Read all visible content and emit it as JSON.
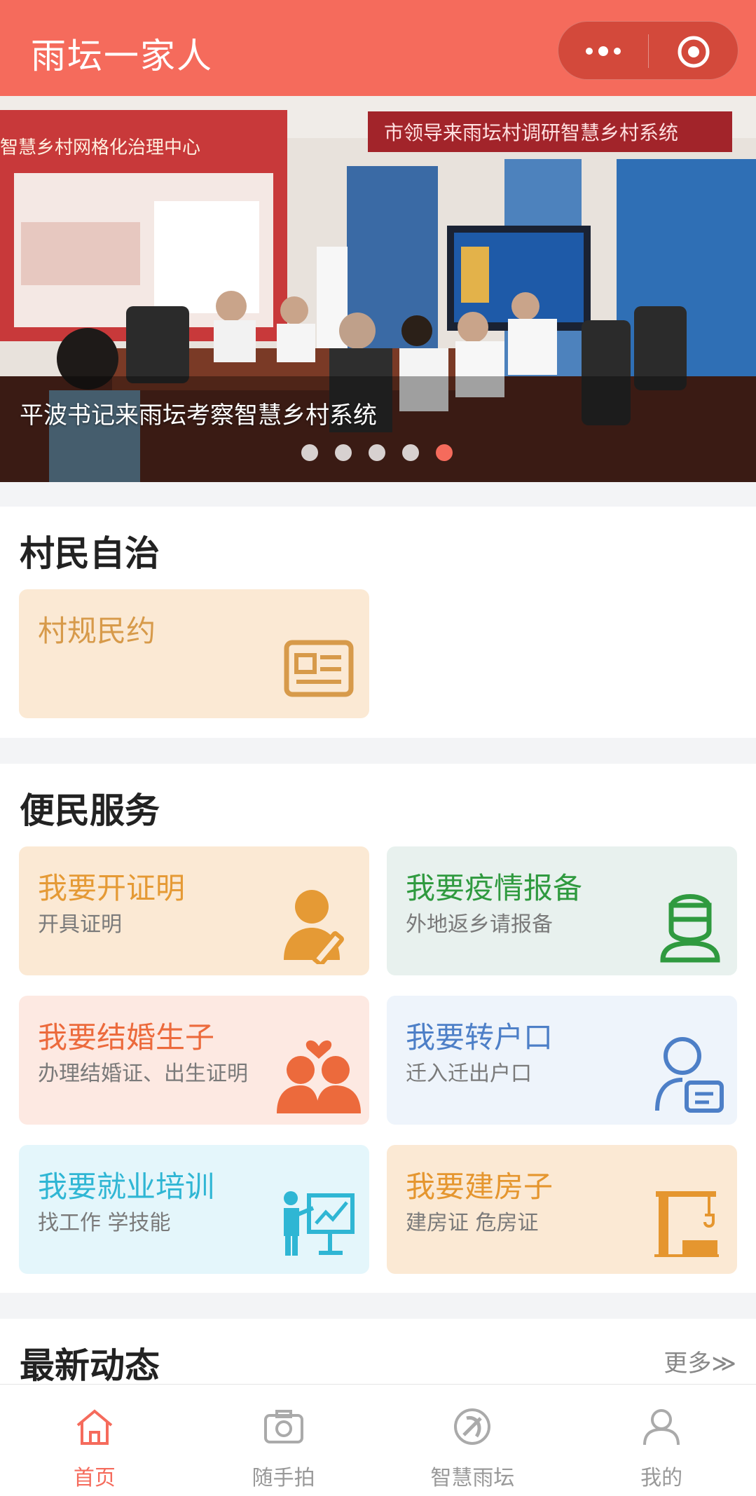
{
  "app": {
    "title": "雨坛一家人"
  },
  "banner": {
    "caption": "平波书记来雨坛考察智慧乡村系统",
    "sign_text": "市领导来雨坛村调研智慧乡村系统",
    "wall_text": "智慧乡村网格化治理中心",
    "page_count": 5,
    "active_index": 4
  },
  "section1": {
    "heading": "村民自治",
    "cards": [
      {
        "title": "村规民约",
        "icon": "document-icon",
        "color": "#d79a4a",
        "bg": "#fbe9d4"
      }
    ]
  },
  "section2": {
    "heading": "便民服务",
    "cards": [
      {
        "title": "我要开证明",
        "subtitle": "开具证明",
        "icon": "person-pen-icon",
        "color": "#e59a35",
        "bg": "#fbe9d4"
      },
      {
        "title": "我要疫情报备",
        "subtitle": "外地返乡请报备",
        "icon": "masked-person-icon",
        "color": "#2f9a3f",
        "bg": "#e8f1ee"
      },
      {
        "title": "我要结婚生子",
        "subtitle": "办理结婚证、出生证明",
        "icon": "couple-heart-icon",
        "color": "#ec6a3c",
        "bg": "#fde9e2"
      },
      {
        "title": "我要转户口",
        "subtitle": "迁入迁出户口",
        "icon": "person-card-icon",
        "color": "#4d7fc7",
        "bg": "#eef4fb"
      },
      {
        "title": "我要就业培训",
        "subtitle": "找工作 学技能",
        "icon": "presentation-icon",
        "color": "#2fb6d4",
        "bg": "#e4f6fb"
      },
      {
        "title": "我要建房子",
        "subtitle": "建房证 危房证",
        "icon": "crane-icon",
        "color": "#e5962f",
        "bg": "#fbe9d4"
      }
    ]
  },
  "section3": {
    "heading": "最新动态",
    "more": "更多≫"
  },
  "tabbar": {
    "tabs": [
      {
        "label": "首页",
        "icon": "home-icon",
        "active": true
      },
      {
        "label": "随手拍",
        "icon": "camera-icon",
        "active": false
      },
      {
        "label": "智慧雨坛",
        "icon": "party-emblem-icon",
        "active": false
      },
      {
        "label": "我的",
        "icon": "user-icon",
        "active": false
      }
    ]
  },
  "colors": {
    "brand": "#f56b5c",
    "active_dot": "#f56b5c"
  }
}
